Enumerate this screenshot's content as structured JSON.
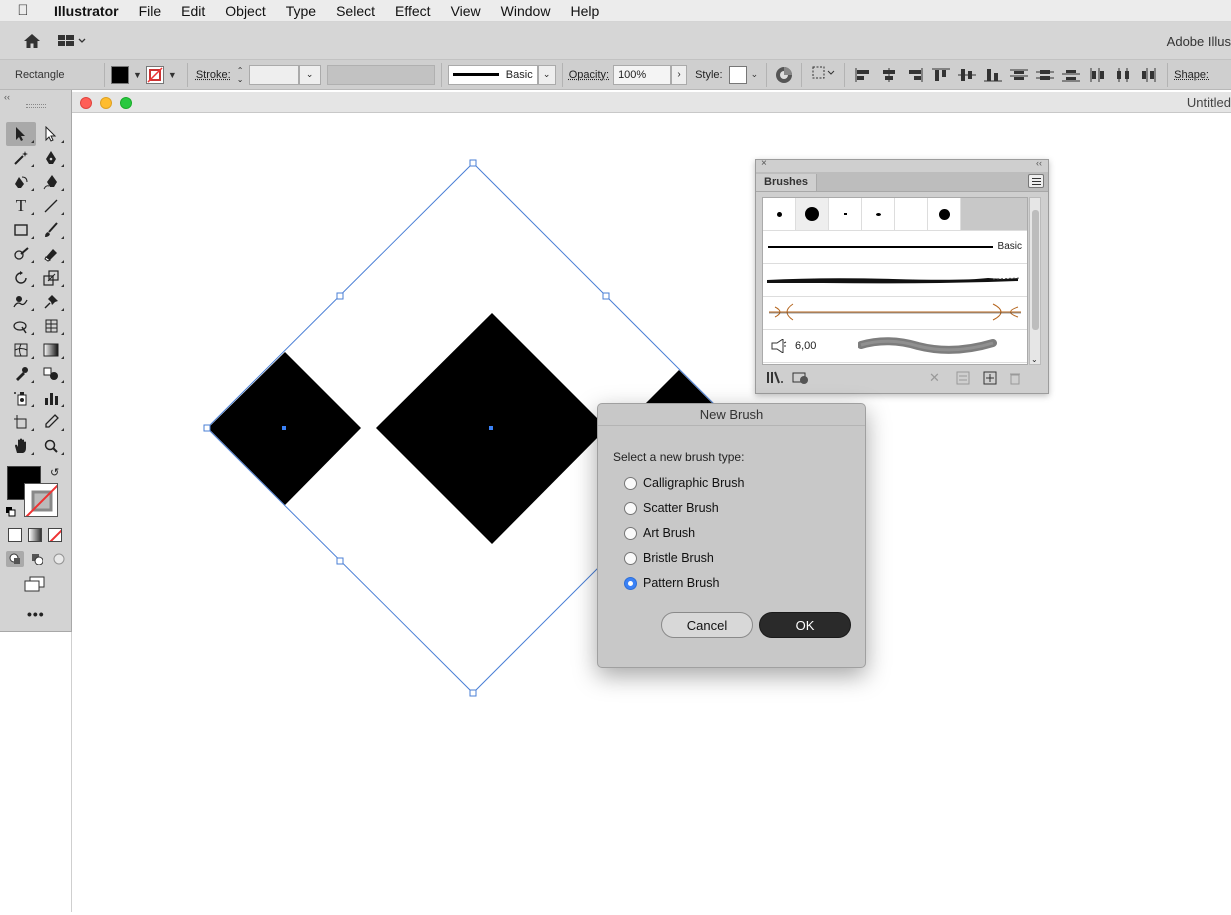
{
  "menubar": {
    "app_name": "Illustrator",
    "items": [
      "File",
      "Edit",
      "Object",
      "Type",
      "Select",
      "Effect",
      "View",
      "Window",
      "Help"
    ]
  },
  "appbar": {
    "label": "Adobe Illus"
  },
  "control_bar": {
    "object_type": "Rectangle",
    "stroke_label": "Stroke:",
    "brush_name": "Basic",
    "opacity_label": "Opacity:",
    "opacity_value": "100%",
    "style_label": "Style:",
    "shape_label": "Shape:"
  },
  "document": {
    "title": "Untitled"
  },
  "brushes_panel": {
    "tab": "Brushes",
    "basic_label": "Basic",
    "size_value": "6,00"
  },
  "new_brush_dialog": {
    "title": "New Brush",
    "prompt": "Select a new brush type:",
    "options": [
      "Calligraphic Brush",
      "Scatter Brush",
      "Art Brush",
      "Bristle Brush",
      "Pattern Brush"
    ],
    "selected_option": "Pattern Brush",
    "cancel_label": "Cancel",
    "ok_label": "OK"
  },
  "colors": {
    "accent": "#3b82f6",
    "selection": "#4a7fd6",
    "art_stroke_brown": "#b5651d"
  }
}
